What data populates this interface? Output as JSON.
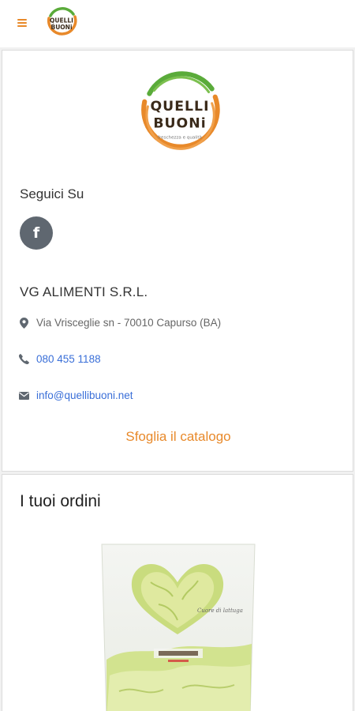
{
  "topbar": {
    "menu_icon": "hamburger-icon",
    "logo_line1": "QUELLI",
    "logo_line2": "BUONi"
  },
  "contact_card": {
    "logo_line1": "QUELLI",
    "logo_line2": "BUONi",
    "logo_tagline": "freschezza e qualità",
    "follow_label": "Seguici Su",
    "facebook_icon": "facebook-icon",
    "facebook_glyph": "f",
    "company_name": "VG ALIMENTI S.R.L.",
    "address": "Via Vrisceglie sn - 70010 Capurso (BA)",
    "phone": "080 455 1188",
    "email": "info@quellibuoni.net",
    "catalog_link": "Sfoglia il catalogo"
  },
  "orders_card": {
    "title": "I tuoi ordini",
    "product_label_script": "Cuore di lattuga"
  },
  "colors": {
    "accent_orange": "#e8892a",
    "brand_green": "#5aab3a",
    "link_blue": "#3a6fd8",
    "icon_grey": "#5f6770"
  }
}
